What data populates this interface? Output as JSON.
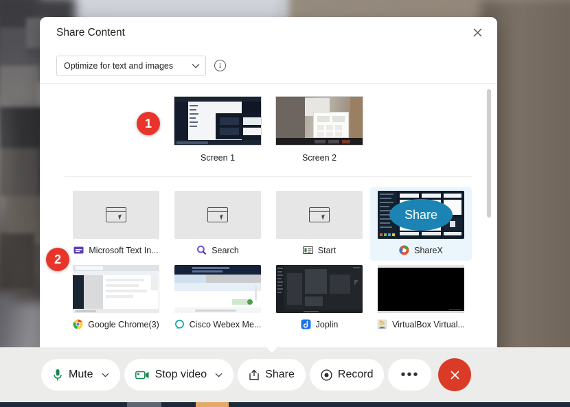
{
  "app": {
    "background_description": "blurred webcam video of a room with whiteboard and door"
  },
  "dialog": {
    "title": "Share Content",
    "close_label": "×",
    "close_icon": "close-icon",
    "optimize_select": {
      "value": "Optimize for text and images",
      "chevron": "chevron-down-icon"
    },
    "info_icon": "info-icon",
    "screens": [
      {
        "label": "Screen 1",
        "kind": "desktop-dark-ide"
      },
      {
        "label": "Screen 2",
        "kind": "webcam-room"
      }
    ],
    "apps": [
      {
        "label": "Microsoft Text In...",
        "icon": "microsoft-text-input-icon",
        "thumb": "placeholder-window",
        "selected": false,
        "icon_color": "#5b3fb4"
      },
      {
        "label": "Search",
        "icon": "windows-search-icon",
        "thumb": "placeholder-window",
        "selected": false,
        "icon_color": "#6b4fd8"
      },
      {
        "label": "Start",
        "icon": "windows-start-icon",
        "thumb": "placeholder-window",
        "selected": false,
        "icon_color": "#3a7a3a"
      },
      {
        "label": "ShareX",
        "icon": "sharex-icon",
        "thumb": "sharex-window",
        "selected": true,
        "icon_color": "#e8512e",
        "hover_button": "Share"
      },
      {
        "label": "Google Chrome(3)",
        "icon": "google-chrome-icon",
        "thumb": "browser-light",
        "selected": false,
        "icon_color": "#ea4335"
      },
      {
        "label": "Cisco Webex Me...",
        "icon": "cisco-webex-icon",
        "thumb": "webex-window",
        "selected": false,
        "icon_color": "#16a0a0"
      },
      {
        "label": "Joplin",
        "icon": "joplin-icon",
        "thumb": "joplin-dark",
        "selected": false,
        "icon_color": "#1a73e8"
      },
      {
        "label": "VirtualBox Virtual...",
        "icon": "virtualbox-icon",
        "thumb": "black-window",
        "selected": false,
        "icon_color": "#c9a227"
      }
    ],
    "scrollbar": {
      "name": "vertical-scrollbar"
    }
  },
  "annotations": [
    {
      "id": "1",
      "text": "1"
    },
    {
      "id": "2",
      "text": "2"
    }
  ],
  "toolbar": {
    "buttons": [
      {
        "label": "Mute",
        "icon": "microphone-icon",
        "has_caret": true
      },
      {
        "label": "Stop video",
        "icon": "video-camera-icon",
        "has_caret": true
      },
      {
        "label": "Share",
        "icon": "share-upload-icon",
        "has_caret": false
      },
      {
        "label": "Record",
        "icon": "record-circle-icon",
        "has_caret": false
      }
    ],
    "more_label": "•••",
    "more_icon": "more-options-icon",
    "leave_label": "×",
    "leave_icon": "leave-meeting-icon",
    "leave_color": "#d93b26"
  },
  "colors": {
    "accent_blue": "#1b84b5",
    "selected_tile": "#eaf6fb",
    "badge_red": "#e8342a",
    "leave_red": "#d93b26",
    "toolbar_bg": "#ececeb"
  }
}
